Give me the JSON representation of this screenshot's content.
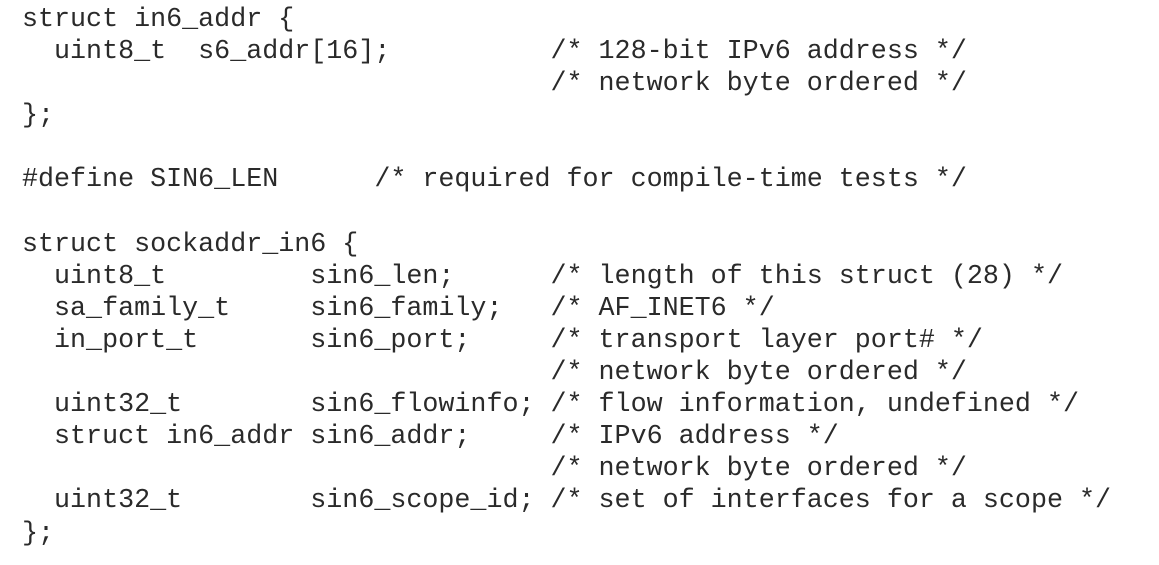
{
  "code": {
    "lines": [
      "struct in6_addr {",
      "  uint8_t  s6_addr[16];          /* 128-bit IPv6 address */",
      "                                 /* network byte ordered */",
      "};",
      "",
      "#define SIN6_LEN      /* required for compile-time tests */",
      "",
      "struct sockaddr_in6 {",
      "  uint8_t         sin6_len;      /* length of this struct (28) */",
      "  sa_family_t     sin6_family;   /* AF_INET6 */",
      "  in_port_t       sin6_port;     /* transport layer port# */",
      "                                 /* network byte ordered */",
      "  uint32_t        sin6_flowinfo; /* flow information, undefined */",
      "  struct in6_addr sin6_addr;     /* IPv6 address */",
      "                                 /* network byte ordered */",
      "  uint32_t        sin6_scope_id; /* set of interfaces for a scope */",
      "};"
    ]
  }
}
